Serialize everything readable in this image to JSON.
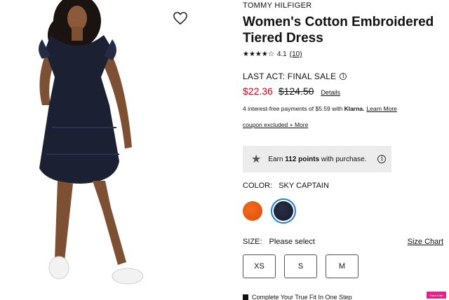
{
  "product": {
    "brand": "TOMMY HILFIGER",
    "title": "Women's Cotton Embroidered Tiered Dress",
    "rating": {
      "stars_value": 4.1,
      "stars_glyphs": "★★★★☆",
      "value_text": "4.1",
      "count_text": "(10)"
    },
    "sale_label": "LAST ACT: FINAL SALE",
    "sale_price": "$22.36",
    "original_price": "$124.50",
    "details_link": "Details"
  },
  "klarna": {
    "prefix": "4 interest-free payments of $5.59 with ",
    "brand": "Klarna.",
    "learn_more": "Learn More"
  },
  "coupon": {
    "text": "coupon excluded + More"
  },
  "points": {
    "prefix": "Earn ",
    "amount": "112 points",
    "suffix": " with purchase."
  },
  "color": {
    "label": "COLOR:",
    "selected": "SKY CAPTAIN",
    "swatches": [
      {
        "name": "orange",
        "color": "#f26a1e",
        "selected": false
      },
      {
        "name": "navy",
        "color": "#1c2033",
        "selected": true
      }
    ]
  },
  "size": {
    "label": "SIZE:",
    "prompt": "Please select",
    "chart_link": "Size Chart",
    "options": [
      "XS",
      "S",
      "M"
    ]
  },
  "fit": {
    "text": "Complete Your True Fit In One Step",
    "badge": "Paint It Me"
  },
  "icons": {
    "wishlist": "heart-outline-icon",
    "info": "info-icon",
    "points": "star-icon",
    "fit": "true-fit-icon"
  },
  "colors": {
    "sale_red": "#d0021b",
    "selected_ring": "#1c7ed6",
    "points_bg": "#ececec"
  }
}
